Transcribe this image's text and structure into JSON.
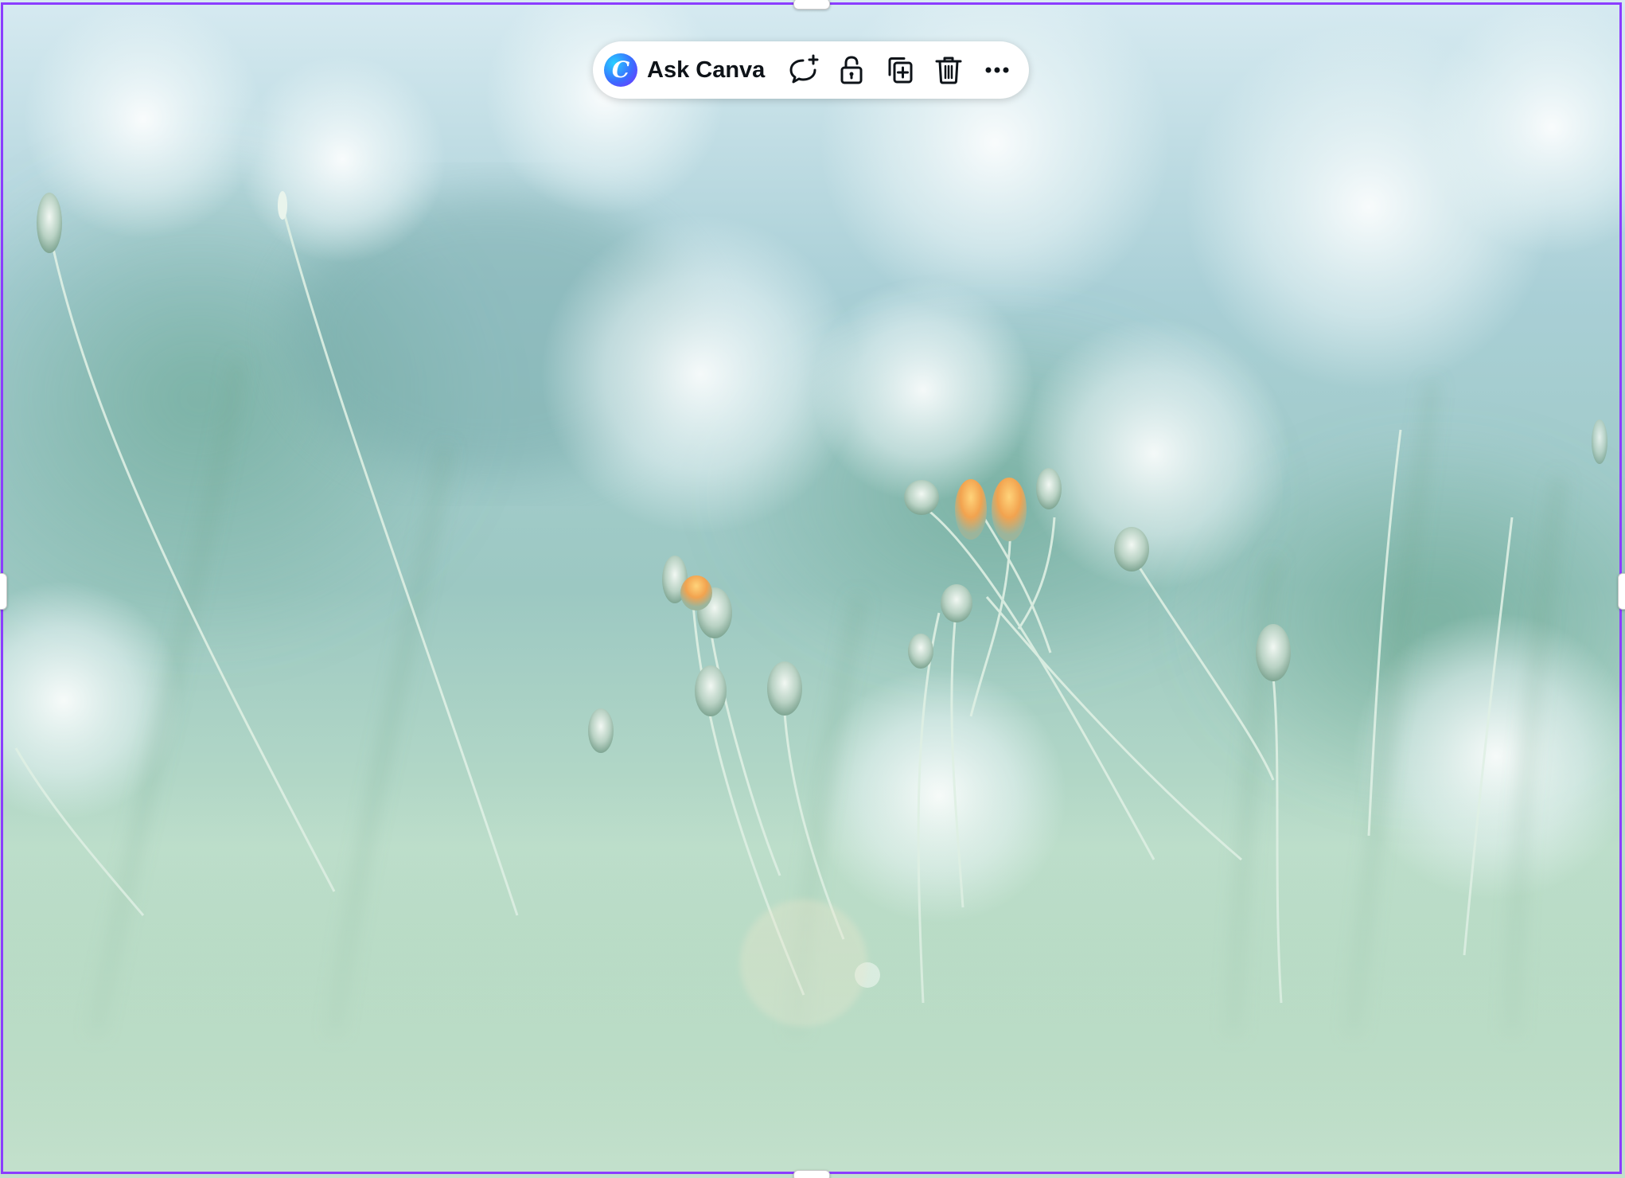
{
  "toolbar": {
    "ask_canva_label": "Ask Canva",
    "logo_letter": "C",
    "buttons": [
      {
        "icon": "comment-add-icon"
      },
      {
        "icon": "unlock-icon"
      },
      {
        "icon": "duplicate-icon"
      },
      {
        "icon": "trash-icon"
      },
      {
        "icon": "more-icon"
      }
    ]
  },
  "colors": {
    "selection": "#8b3dff",
    "icon": "#0e1318"
  }
}
